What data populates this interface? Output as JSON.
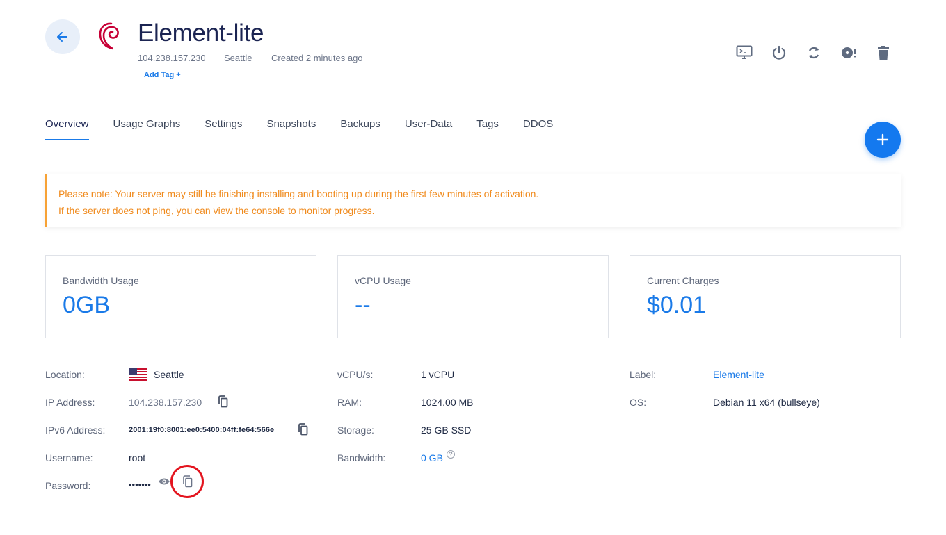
{
  "header": {
    "title": "Element-lite",
    "ip": "104.238.157.230",
    "location": "Seattle",
    "created": "Created 2 minutes ago",
    "add_tag": "Add Tag +"
  },
  "toolbar": [
    "console-icon",
    "power-icon",
    "restart-icon",
    "reinstall-icon",
    "trash-icon"
  ],
  "tabs": [
    "Overview",
    "Usage Graphs",
    "Settings",
    "Snapshots",
    "Backups",
    "User-Data",
    "Tags",
    "DDOS"
  ],
  "notice": {
    "line1": "Please note: Your server may still be finishing installing and booting up during the first few minutes of activation.",
    "line2_pre": "If the server does not ping, you can ",
    "line2_link": "view the console",
    "line2_post": " to monitor progress."
  },
  "cards": [
    {
      "label": "Bandwidth Usage",
      "value": "0GB"
    },
    {
      "label": "vCPU Usage",
      "value": "--"
    },
    {
      "label": "Current Charges",
      "value": "$0.01"
    }
  ],
  "details": {
    "location_label": "Location:",
    "location_value": "Seattle",
    "ip_label": "IP Address:",
    "ip_value": "104.238.157.230",
    "ipv6_label": "IPv6 Address:",
    "ipv6_value": "2001:19f0:8001:ee0:5400:04ff:fe64:566e",
    "username_label": "Username:",
    "username_value": "root",
    "password_label": "Password:",
    "password_value": "•••••••",
    "vcpu_label": "vCPU/s:",
    "vcpu_value": "1 vCPU",
    "ram_label": "RAM:",
    "ram_value": "1024.00 MB",
    "storage_label": "Storage:",
    "storage_value": "25 GB SSD",
    "bandwidth_label": "Bandwidth:",
    "bandwidth_value": "0 GB",
    "bandwidth_help": "?",
    "label_label": "Label:",
    "label_value": "Element-lite",
    "os_label": "OS:",
    "os_value": "Debian 11 x64 (bullseye)"
  },
  "colors": {
    "accent": "#1a7ae8",
    "warning": "#f08a1c",
    "highlight": "#e3141e",
    "title": "#1b2452"
  }
}
